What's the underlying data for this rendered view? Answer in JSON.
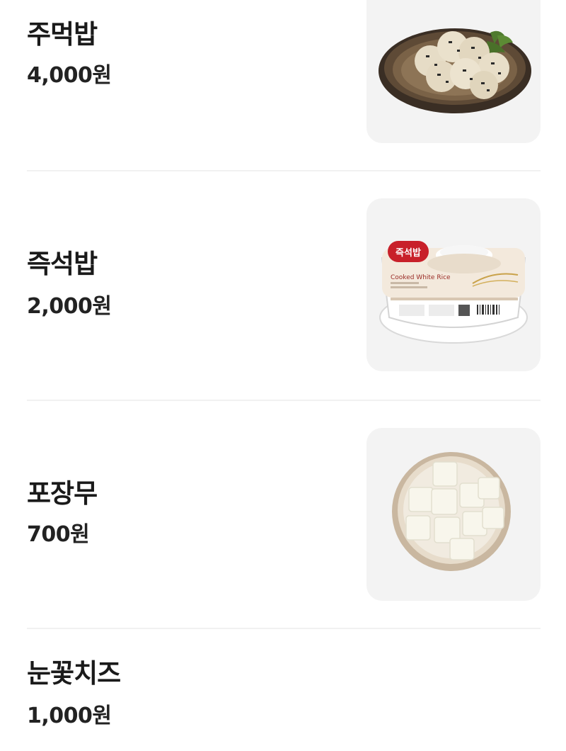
{
  "menu": {
    "items": [
      {
        "name": "주먹밥",
        "price": "4,000원"
      },
      {
        "name": "즉석밥",
        "price": "2,000원"
      },
      {
        "name": "포장무",
        "price": "700원"
      },
      {
        "name": "눈꽃치즈",
        "price": "1,000원"
      }
    ]
  },
  "product_package": {
    "brand_label": "즉석밥",
    "subtitle": "Cooked White Rice"
  },
  "colors": {
    "text_primary": "#1a1a1a",
    "thumb_background": "#f3f3f3",
    "divider": "#f1f1f1"
  }
}
